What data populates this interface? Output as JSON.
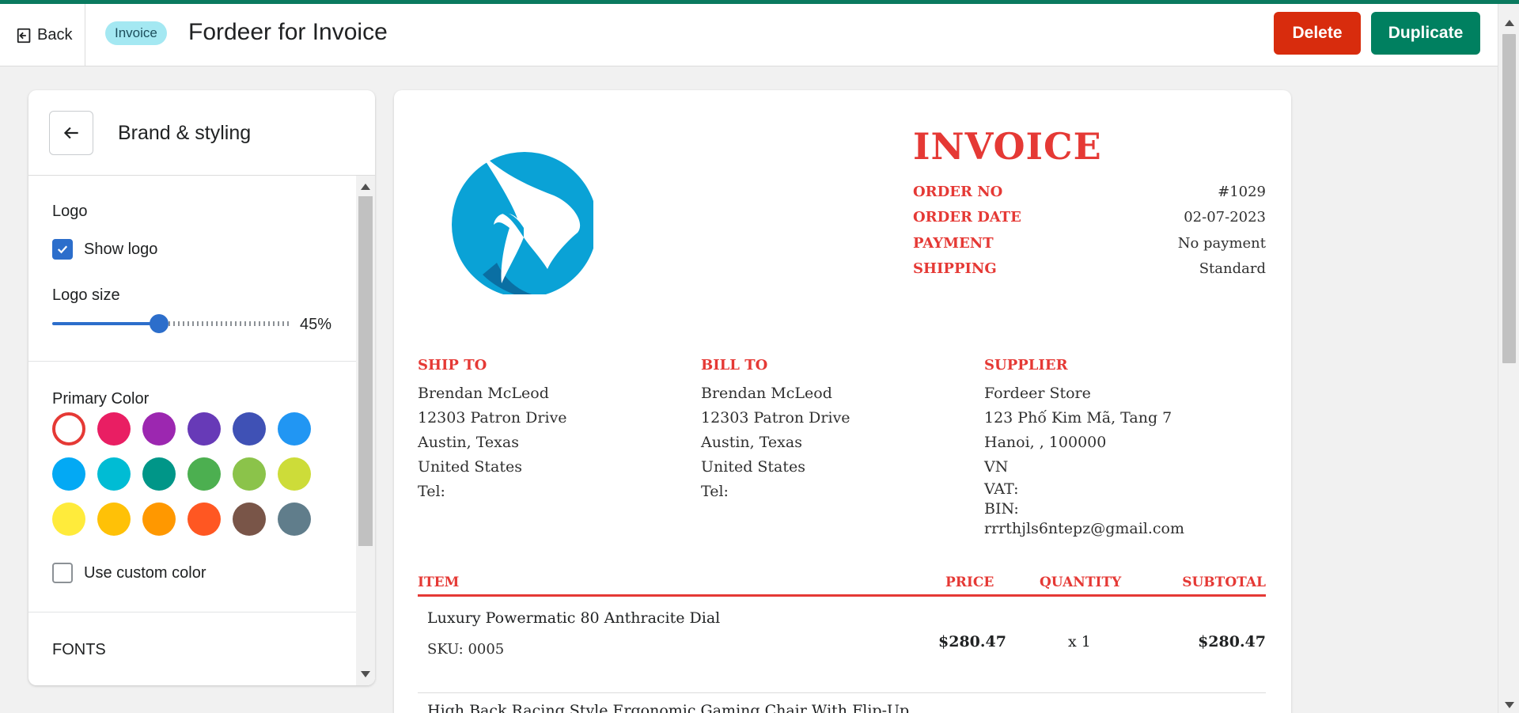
{
  "header": {
    "back_label": "Back",
    "badge": "Invoice",
    "title": "Fordeer for Invoice",
    "delete_label": "Delete",
    "duplicate_label": "Duplicate"
  },
  "panel": {
    "title": "Brand & styling",
    "logo_heading": "Logo",
    "show_logo_label": "Show logo",
    "show_logo_checked": true,
    "logo_size_label": "Logo size",
    "logo_size_value": "45%",
    "logo_size_fraction": 0.45,
    "primary_color_heading": "Primary Color",
    "colors": [
      "#e53935",
      "#e91e63",
      "#9c27b0",
      "#673ab7",
      "#3f51b5",
      "#2196f3",
      "#03a9f4",
      "#00bcd4",
      "#009688",
      "#4caf50",
      "#8bc34a",
      "#cddc39",
      "#ffeb3b",
      "#ffc107",
      "#ff9800",
      "#ff5722",
      "#795548",
      "#607d8b"
    ],
    "selected_color_index": 0,
    "custom_color_label": "Use custom color",
    "custom_color_checked": false,
    "fonts_heading": "FONTS"
  },
  "invoice": {
    "title": "INVOICE",
    "accent_color": "#e53935",
    "meta": [
      {
        "key": "ORDER NO",
        "value": "#1029"
      },
      {
        "key": "ORDER DATE",
        "value": "02-07-2023"
      },
      {
        "key": "PAYMENT",
        "value": "No payment"
      },
      {
        "key": "SHIPPING",
        "value": "Standard"
      }
    ],
    "ship_to": {
      "heading": "SHIP TO",
      "lines": [
        "Brendan McLeod",
        "12303 Patron Drive",
        "Austin, Texas",
        "United States",
        "Tel:"
      ]
    },
    "bill_to": {
      "heading": "BILL TO",
      "lines": [
        "Brendan McLeod",
        "12303 Patron Drive",
        "Austin, Texas",
        "United States",
        "Tel:"
      ]
    },
    "supplier": {
      "heading": "SUPPLIER",
      "lines": [
        "Fordeer Store",
        "123 Phố Kim Mã, Tang 7",
        "Hanoi, , 100000",
        "VN",
        "VAT:",
        "BIN:",
        "rrrthjls6ntepz@gmail.com"
      ]
    },
    "columns": {
      "item": "ITEM",
      "price": "PRICE",
      "quantity": "QUANTITY",
      "subtotal": "SUBTOTAL"
    },
    "items": [
      {
        "name": "Luxury Powermatic 80 Anthracite Dial",
        "sku": "SKU: 0005",
        "price": "$280.47",
        "quantity": "x 1",
        "subtotal": "$280.47"
      },
      {
        "name": "High Back Racing Style Ergonomic Gaming Chair With Flip-Up"
      }
    ]
  }
}
